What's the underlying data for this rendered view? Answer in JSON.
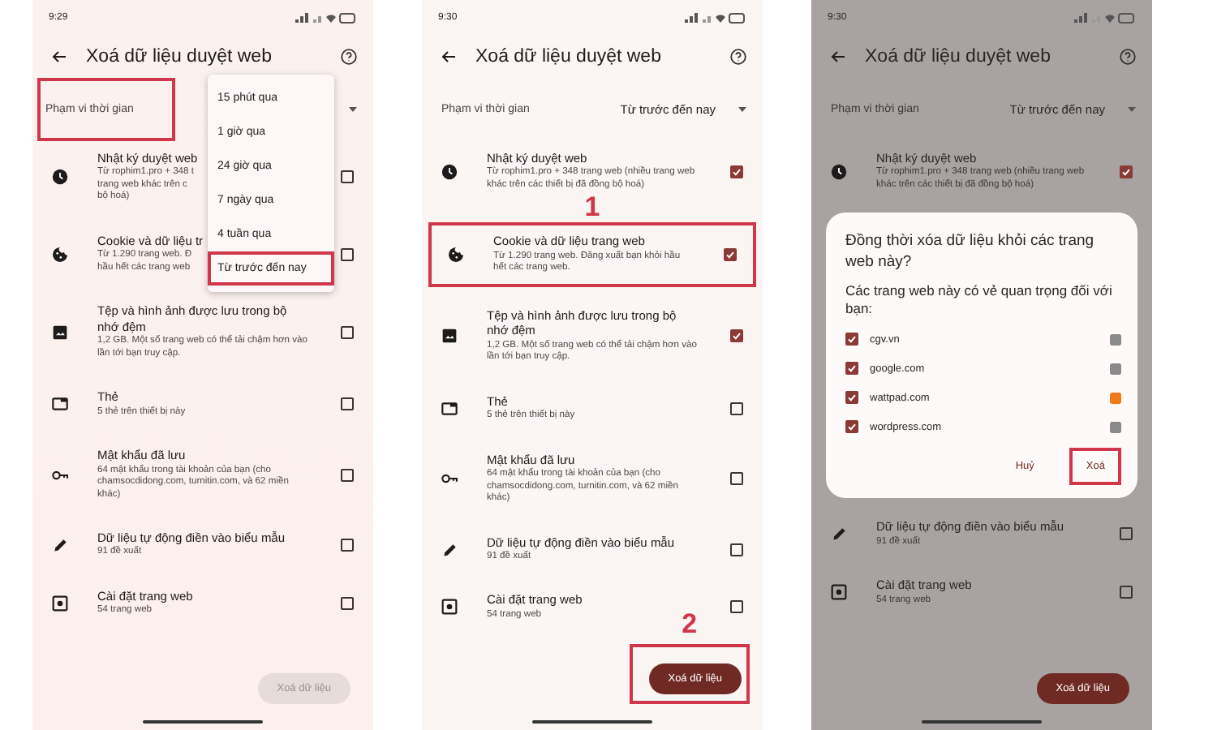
{
  "phones": [
    {
      "status_time": "9:29",
      "title": "Xoá dữ liệu duyệt web",
      "dimmed": false,
      "range": {
        "label": "Phạm vi thời gian",
        "highlighted": true
      },
      "menu": {
        "options": [
          {
            "label": "15 phút qua",
            "highlighted": false
          },
          {
            "label": "1 giờ qua",
            "highlighted": false
          },
          {
            "label": "24 giờ qua",
            "highlighted": false
          },
          {
            "label": "7 ngày qua",
            "highlighted": false
          },
          {
            "label": "4 tuần qua",
            "highlighted": false
          },
          {
            "label": "Từ trước đến nay",
            "highlighted": true
          }
        ]
      },
      "blocks": [
        {
          "kind": "history",
          "title": "Nhật ký duyệt web",
          "desc": "Từ rophim1.pro + 348 t\ntrang web khác trên c\nbộ hoá)",
          "checked": false,
          "under_menu": true,
          "highlighted": false
        },
        {
          "kind": "cookies",
          "title": "Cookie và dữ liệu tr",
          "desc": "Từ 1.290 trang web. Đ\nhầu hết các trang web",
          "checked": false,
          "under_menu": true,
          "highlighted": false
        },
        {
          "kind": "cache",
          "title": "Tệp và hình ảnh được lưu trong bộ nhớ đệm",
          "desc": "1,2 GB. Một số trang web có thể tải chậm hơn vào lần tới bạn truy cập.",
          "checked": false,
          "under_menu": false,
          "highlighted": false
        },
        {
          "kind": "tabs",
          "title": "Thẻ",
          "desc": "5 thẻ trên thiết bị này",
          "checked": false,
          "under_menu": false,
          "highlighted": false
        },
        {
          "kind": "passwords",
          "title": "Mật khẩu đã lưu",
          "desc": "64 mật khẩu trong tài khoản của bạn (cho chamsocdidong.com, turnitin.com, và 62 miền khác)",
          "checked": false,
          "under_menu": false,
          "highlighted": false
        },
        {
          "kind": "autofill",
          "title": "Dữ liệu tự động điền vào biểu mẫu",
          "desc": "91 đề xuất",
          "checked": false,
          "under_menu": false,
          "highlighted": false
        },
        {
          "kind": "site_settings",
          "title": "Cài đặt trang web",
          "desc": "54 trang web",
          "checked": false,
          "under_menu": false,
          "highlighted": false
        }
      ],
      "button": {
        "label": "Xoá dữ liệu",
        "enabled": false,
        "highlighted": false
      }
    },
    {
      "status_time": "9:30",
      "title": "Xoá dữ liệu duyệt web",
      "dimmed": false,
      "range": {
        "label": "Phạm vi thời gian",
        "value": "Từ trước đến nay",
        "highlighted": false
      },
      "blocks": [
        {
          "kind": "history",
          "title": "Nhật ký duyệt web",
          "desc": "Từ rophim1.pro + 348 trang web (nhiều trang web khác trên các thiết bị đã đồng bộ hoá)",
          "checked": true,
          "under_menu": false,
          "highlighted": false
        },
        {
          "kind": "cookies",
          "title": "Cookie và dữ liệu trang web",
          "desc": "Từ 1.290 trang web. Đăng xuất bạn khỏi hầu hết các trang web.",
          "checked": true,
          "under_menu": false,
          "highlighted": true,
          "step": "1"
        },
        {
          "kind": "cache",
          "title": "Tệp và hình ảnh được lưu trong bộ nhớ đệm",
          "desc": "1,2 GB. Một số trang web có thể tải chậm hơn vào lần tới bạn truy cập.",
          "checked": true,
          "under_menu": false,
          "highlighted": false
        },
        {
          "kind": "tabs",
          "title": "Thẻ",
          "desc": "5 thẻ trên thiết bị này",
          "checked": false,
          "under_menu": false,
          "highlighted": false
        },
        {
          "kind": "passwords",
          "title": "Mật khẩu đã lưu",
          "desc": "64 mật khẩu trong tài khoản của bạn (cho chamsocdidong.com, turnitin.com, và 62 miền khác)",
          "checked": false,
          "under_menu": false,
          "highlighted": false
        },
        {
          "kind": "autofill",
          "title": "Dữ liệu tự động điền vào biểu mẫu",
          "desc": "91 đề xuất",
          "checked": false,
          "under_menu": false,
          "highlighted": false
        },
        {
          "kind": "site_settings",
          "title": "Cài đặt trang web",
          "desc": "54 trang web",
          "checked": false,
          "under_menu": false,
          "highlighted": false
        }
      ],
      "button": {
        "label": "Xoá dữ liệu",
        "enabled": true,
        "highlighted": true,
        "step": "2"
      }
    },
    {
      "status_time": "9:30",
      "title": "Xoá dữ liệu duyệt web",
      "dimmed": true,
      "range": {
        "label": "Phạm vi thời gian",
        "value": "Từ trước đến nay",
        "highlighted": false
      },
      "blocks": [
        {
          "kind": "history",
          "title": "Nhật ký duyệt web",
          "desc": "Từ rophim1.pro + 348 trang web (nhiều trang web khác trên các thiết bị đã đồng bộ hoá)",
          "checked": true,
          "under_menu": false,
          "highlighted": false
        },
        {
          "kind": "dialog",
          "title": "Đồng thời xóa dữ liệu khỏi các trang web này?",
          "subtitle": "Các trang web này có vẻ quan trọng đối với bạn:",
          "sites": [
            {
              "name": "cgv.vn",
              "checked": true,
              "color": "#8a8a8a"
            },
            {
              "name": "google.com",
              "checked": true,
              "color": "#8a8a8a"
            },
            {
              "name": "wattpad.com",
              "checked": true,
              "color": "#f07a1a"
            },
            {
              "name": "wordpress.com",
              "checked": true,
              "color": "#8a8a8a"
            }
          ],
          "cancel": {
            "label": "Huỷ",
            "highlighted": false
          },
          "confirm": {
            "label": "Xoá",
            "highlighted": true
          }
        },
        {
          "kind": "autofill",
          "title": "Dữ liệu tự động điền vào biểu mẫu",
          "desc": "91 đề xuất",
          "checked": false,
          "under_menu": false,
          "highlighted": false
        },
        {
          "kind": "site_settings",
          "title": "Cài đặt trang web",
          "desc": "54 trang web",
          "checked": false,
          "under_menu": false,
          "highlighted": false
        }
      ],
      "button": {
        "label": "Xoá dữ liệu",
        "enabled": true,
        "highlighted": false
      }
    }
  ]
}
